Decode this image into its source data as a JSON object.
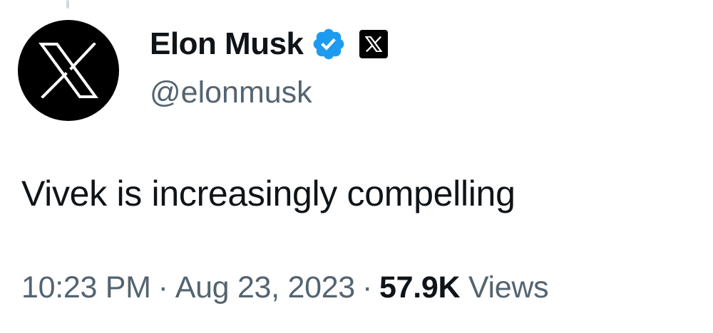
{
  "user": {
    "display_name": "Elon Musk",
    "handle": "@elonmusk",
    "avatar_icon": "x-logo-icon",
    "verified_icon": "verified-badge-icon",
    "affiliate_icon": "x-affiliate-badge-icon",
    "verified_color": "#1d9bf0"
  },
  "tweet": {
    "text": "Vivek is increasingly compelling",
    "time": "10:23 PM",
    "separator": "·",
    "date": "Aug 23, 2023",
    "views_count": "57.9K",
    "views_label": "Views"
  },
  "colors": {
    "text_primary": "#0f1419",
    "text_secondary": "#536471",
    "background": "#ffffff"
  }
}
